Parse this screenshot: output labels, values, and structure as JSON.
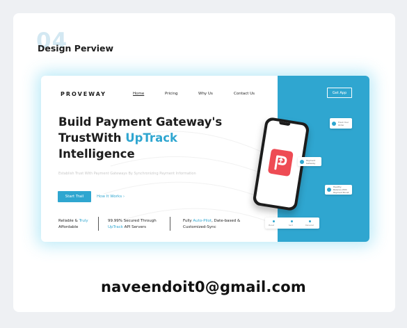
{
  "section": {
    "number": "04",
    "title": "Design Perview"
  },
  "preview": {
    "logo": "PROVEWAY",
    "nav": [
      {
        "label": "Home",
        "active": true
      },
      {
        "label": "Pricing",
        "active": false
      },
      {
        "label": "Why Us",
        "active": false
      },
      {
        "label": "Contact Us",
        "active": false
      }
    ],
    "get_app_label": "Get App",
    "headline": {
      "line1": "Build Payment Gateway's",
      "line2_pre": "TrustWith ",
      "line2_accent": "UpTrack",
      "line3": "Intelligence"
    },
    "subtext": "Establish Trust With Payment Gateways By Synchronizing Payment Information",
    "start_button": "Start Trail",
    "how_link": "How It Works",
    "features": [
      {
        "pre": "Reliable & ",
        "accent": "Truly",
        "post": "",
        "line2": "Affordable"
      },
      {
        "pre": "99.99% Secured Through",
        "accent": "",
        "post": "",
        "line2_accent": "UpTrack",
        "line2": " API Servers"
      },
      {
        "pre": "Fully ",
        "accent": "Auto-Pilot",
        "post": ", Date-based &",
        "line2": "Customized-Sync"
      }
    ],
    "bubbles": [
      {
        "text": "Track Your Order"
      },
      {
        "text": "Payment Gateway"
      },
      {
        "text": "Healthy Balance With Payment Boost"
      }
    ],
    "strip_labels": [
      "Placed",
      "Sent",
      "Delivered"
    ],
    "colors": {
      "accent": "#2fa6d0",
      "app_icon": "#ee4b54"
    }
  },
  "email": "naveendoit0@gmail.com"
}
